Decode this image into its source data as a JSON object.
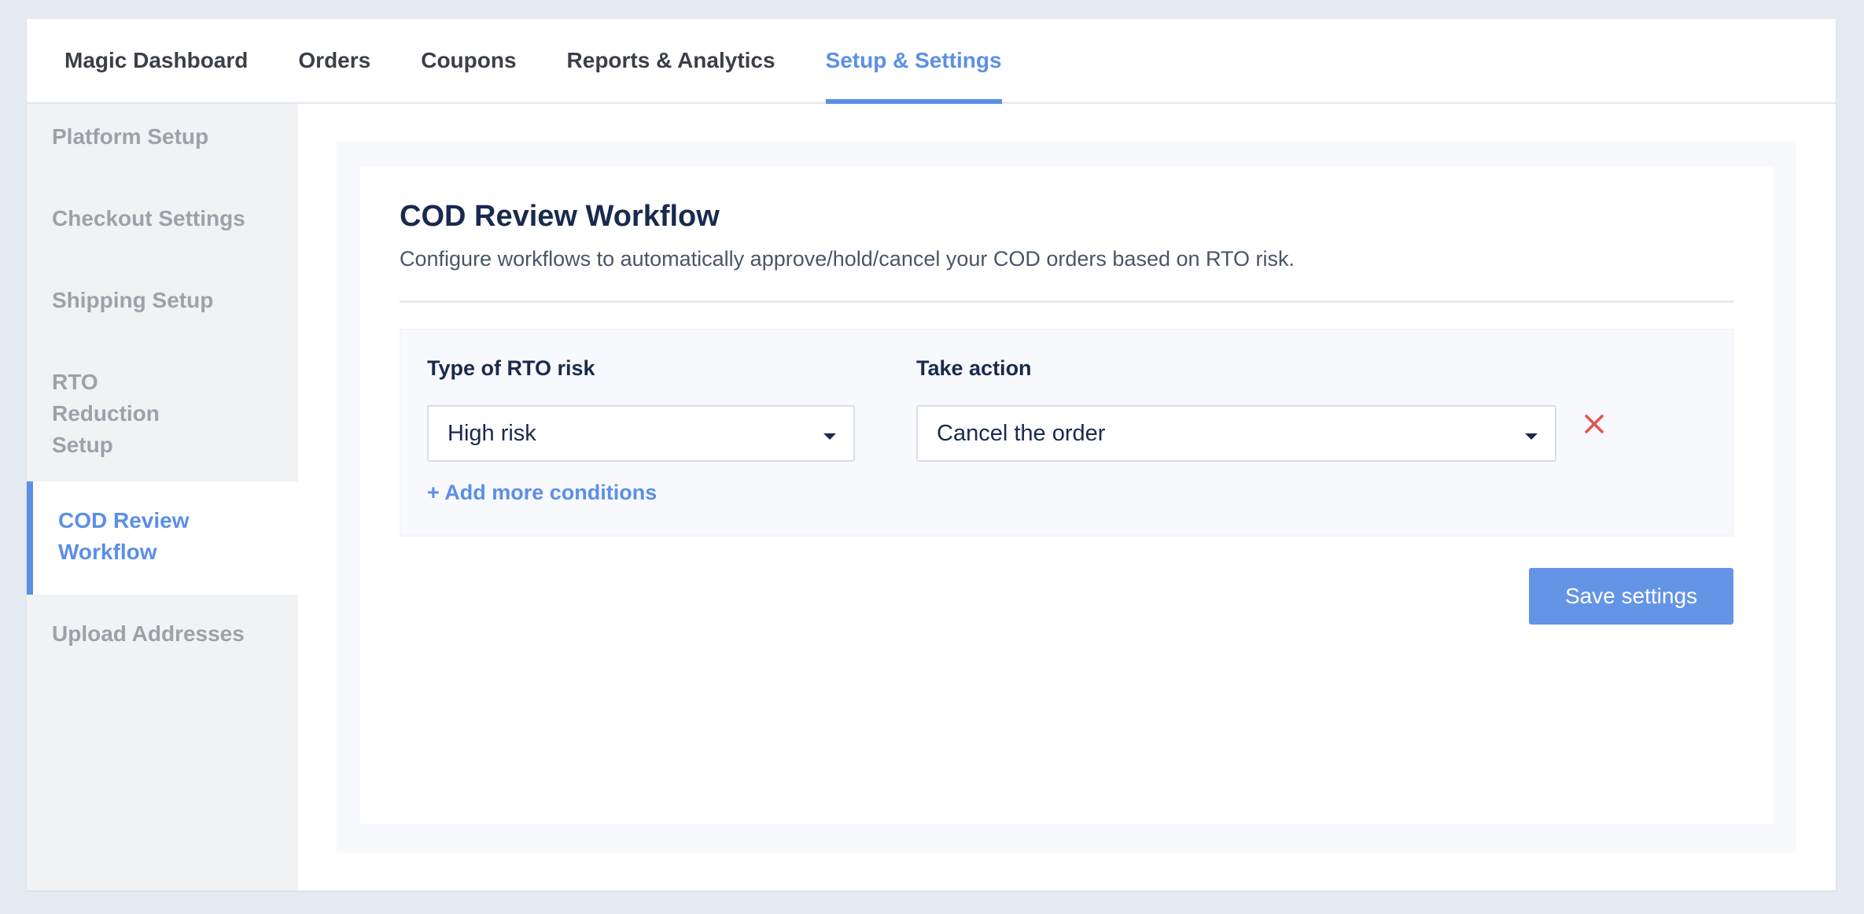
{
  "topnav": {
    "tabs": [
      {
        "label": "Magic Dashboard"
      },
      {
        "label": "Orders"
      },
      {
        "label": "Coupons"
      },
      {
        "label": "Reports & Analytics"
      },
      {
        "label": "Setup & Settings",
        "active": true
      }
    ]
  },
  "sidebar": {
    "items": [
      {
        "label": "Platform Setup"
      },
      {
        "label": "Checkout Settings"
      },
      {
        "label": "Shipping Setup"
      },
      {
        "label": "RTO Reduction Setup"
      },
      {
        "label": "COD Review Workflow",
        "active": true
      },
      {
        "label": "Upload Addresses"
      }
    ]
  },
  "main": {
    "title": "COD Review Workflow",
    "subtitle": "Configure workflows to automatically approve/hold/cancel your COD orders based on RTO risk.",
    "condition": {
      "risk_label": "Type of RTO risk",
      "risk_value": "High risk",
      "action_label": "Take action",
      "action_value": "Cancel the order",
      "add_more": "+ Add more conditions"
    },
    "save_label": "Save settings"
  },
  "colors": {
    "accent": "#5b8fe6",
    "remove": "#e05252",
    "heading": "#182a4e"
  }
}
